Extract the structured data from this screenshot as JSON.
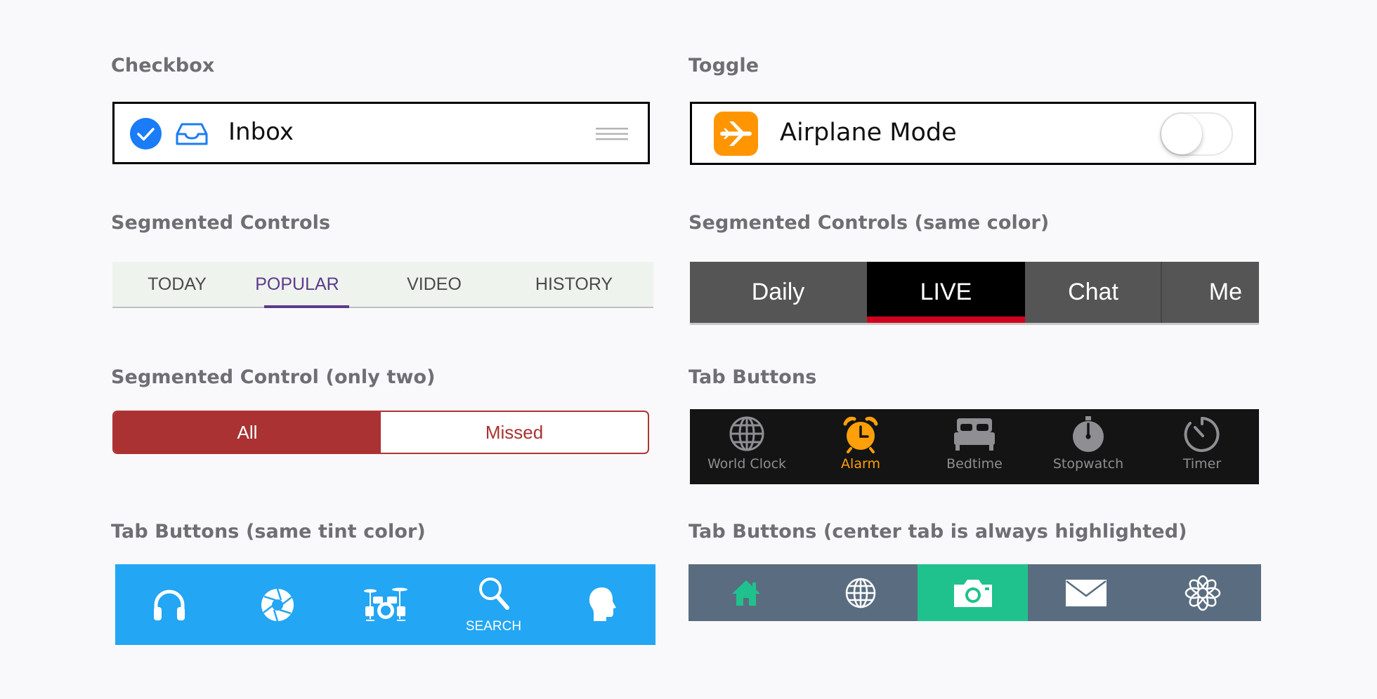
{
  "sections": {
    "checkbox": "Checkbox",
    "toggle": "Toggle",
    "segmented": "Segmented Controls",
    "segmented_same": "Segmented Controls (same color)",
    "segmented_two": "Segmented Control (only two)",
    "tab_buttons": "Tab Buttons",
    "tab_buttons_tint": "Tab Buttons (same tint color)",
    "tab_buttons_center": "Tab Buttons (center tab is always highlighted)"
  },
  "checkbox_row": {
    "label": "Inbox",
    "checked": true,
    "icons": [
      "check-icon",
      "inbox-icon",
      "drag-handle-icon"
    ],
    "accent": "#1a7cf6"
  },
  "toggle_row": {
    "label": "Airplane Mode",
    "on": false,
    "icon": "airplane-icon",
    "icon_bg": "#ff9500"
  },
  "segmented": {
    "tabs": [
      "TODAY",
      "POPULAR",
      "VIDEO",
      "HISTORY"
    ],
    "selected": "POPULAR",
    "accent": "#5b3b8c"
  },
  "segmented_same": {
    "tabs": [
      "Daily",
      "LIVE",
      "Chat",
      "Me"
    ],
    "selected": "LIVE",
    "indicator": "#d0021b"
  },
  "segmented_two": {
    "tabs": [
      "All",
      "Missed"
    ],
    "selected": "All",
    "accent": "#aa3232"
  },
  "tab_buttons": {
    "items": [
      {
        "label": "World Clock",
        "icon": "globe-icon"
      },
      {
        "label": "Alarm",
        "icon": "alarm-clock-icon"
      },
      {
        "label": "Bedtime",
        "icon": "bed-icon"
      },
      {
        "label": "Stopwatch",
        "icon": "stopwatch-icon"
      },
      {
        "label": "Timer",
        "icon": "timer-icon"
      }
    ],
    "selected": "Alarm",
    "accent": "#ff9f0a"
  },
  "tab_buttons_tint": {
    "items": [
      {
        "icon": "headphones-icon"
      },
      {
        "icon": "aperture-icon"
      },
      {
        "icon": "drum-kit-icon"
      },
      {
        "icon": "search-icon",
        "label": "SEARCH"
      },
      {
        "icon": "head-profile-icon"
      }
    ],
    "selected": "SEARCH",
    "background": "#23a6f3"
  },
  "tab_buttons_center": {
    "items": [
      {
        "icon": "home-icon"
      },
      {
        "icon": "globe-icon"
      },
      {
        "icon": "camera-icon"
      },
      {
        "icon": "mail-icon"
      },
      {
        "icon": "flower-icon"
      }
    ],
    "highlighted": "camera-icon",
    "highlight_color": "#1fc28c",
    "background": "#5a6d80"
  }
}
